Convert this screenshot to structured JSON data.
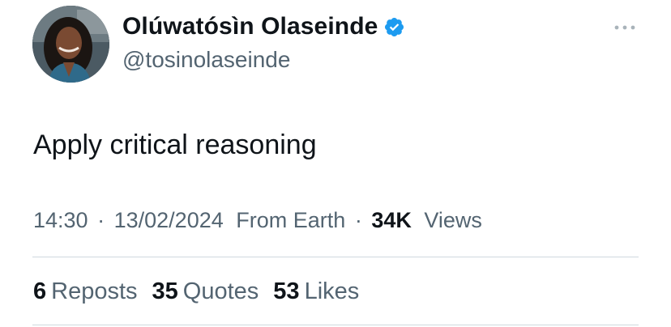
{
  "author": {
    "display_name": "Olúwatósìn Olaseinde",
    "handle": "@tosinolaseinde",
    "verified": true
  },
  "tweet": {
    "text": "Apply critical reasoning"
  },
  "meta": {
    "time": "14:30",
    "separator": "·",
    "date": "13/02/2024",
    "source": "From Earth",
    "views_count": "34K",
    "views_label": "Views"
  },
  "stats": {
    "reposts_count": "6",
    "reposts_label": "Reposts",
    "quotes_count": "35",
    "quotes_label": "Quotes",
    "likes_count": "53",
    "likes_label": "Likes"
  },
  "colors": {
    "verified_badge": "#1d9bf0",
    "secondary_text": "#536471",
    "primary_text": "#0f1419",
    "divider": "#cfd9de"
  },
  "icons": {
    "verified": "verified-badge-icon",
    "more": "more-options-icon"
  }
}
